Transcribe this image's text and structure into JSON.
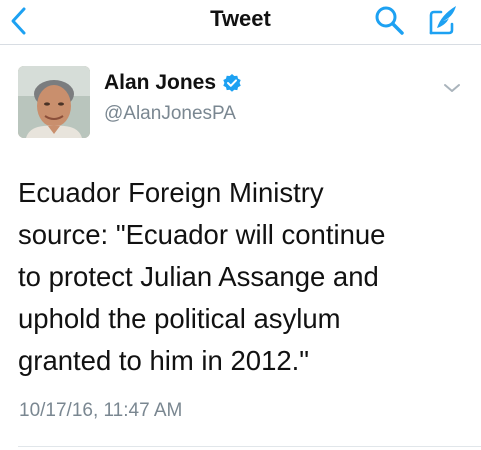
{
  "nav": {
    "title": "Tweet",
    "back_icon": "chevron-left-icon",
    "search_icon": "search-icon",
    "compose_icon": "compose-quill-icon"
  },
  "tweet": {
    "author_name": "Alan Jones",
    "author_handle": "@AlanJonesPA",
    "verified": true,
    "text": "Ecuador Foreign Ministry\nsource: \"Ecuador will continue\nto protect Julian Assange and\nuphold the political asylum\ngranted to him in 2012.\"",
    "timestamp": "10/17/16, 11:47 AM"
  },
  "colors": {
    "accent": "#1da1f2",
    "secondary_text": "#7a8791",
    "primary_text": "#111111"
  }
}
